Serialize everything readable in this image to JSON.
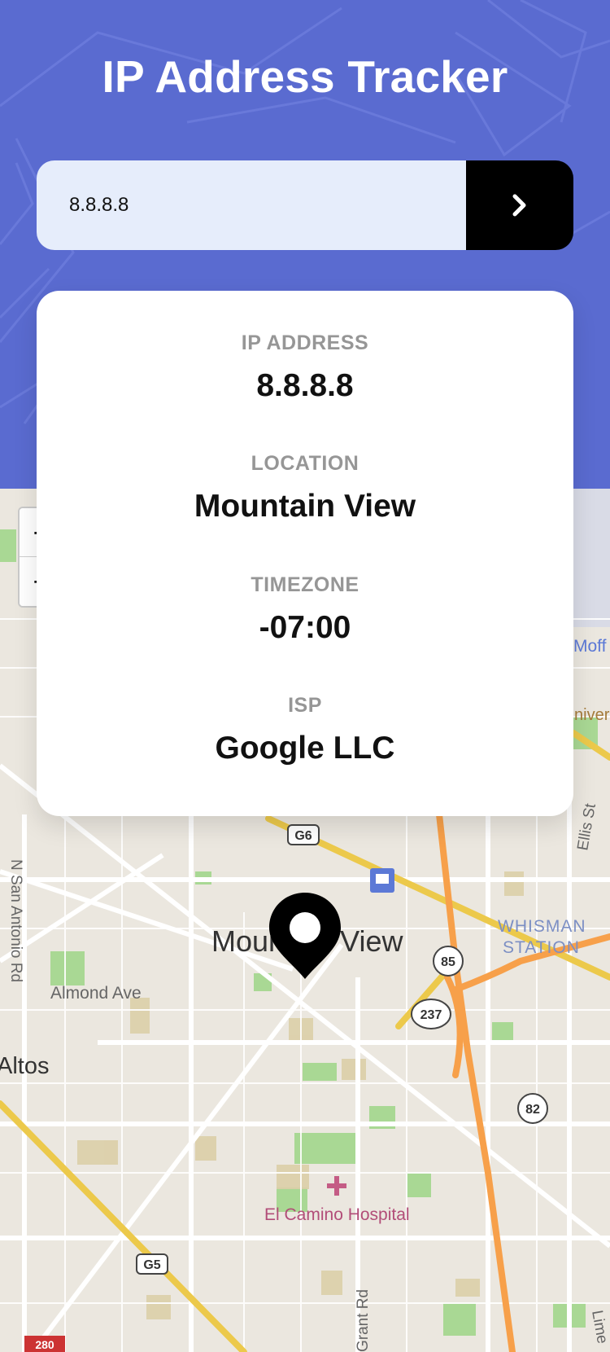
{
  "app": {
    "title": "IP Address Tracker"
  },
  "search": {
    "value": "8.8.8.8",
    "submit_icon": "chevron-right-icon"
  },
  "info": {
    "ip_label": "IP ADDRESS",
    "ip_value": "8.8.8.8",
    "location_label": "LOCATION",
    "location_value": "Mountain View",
    "timezone_label": "TIMEZONE",
    "timezone_value": "-07:00",
    "isp_label": "ISP",
    "isp_value": "Google LLC"
  },
  "map": {
    "zoom_in": "+",
    "zoom_out": "−",
    "marker_icon": "location-pin-icon",
    "labels": {
      "city": "Mountain View",
      "almond": "Almond Ave",
      "altos": "Altos",
      "san_antonio": "N San Antonio Rd",
      "whisman": "WHISMAN",
      "station": "STATION",
      "hospital": "El Camino Hospital",
      "grant": "Grant Rd",
      "ellis": "Ellis St",
      "moff": "Moff",
      "univ": "niversi",
      "lime": "Lime",
      "g6": "G6",
      "g5": "G5",
      "r85": "85",
      "r237": "237",
      "r82": "82",
      "r280": "280"
    }
  },
  "colors": {
    "header": "#5a6bd0",
    "input_bg": "#e6edfb",
    "button": "#000000",
    "map_bg": "#ebe7df",
    "highway_orange": "#f7a04a",
    "highway_yellow": "#ecc94b",
    "park_green": "#9fd38a",
    "label_gray": "#969696"
  }
}
